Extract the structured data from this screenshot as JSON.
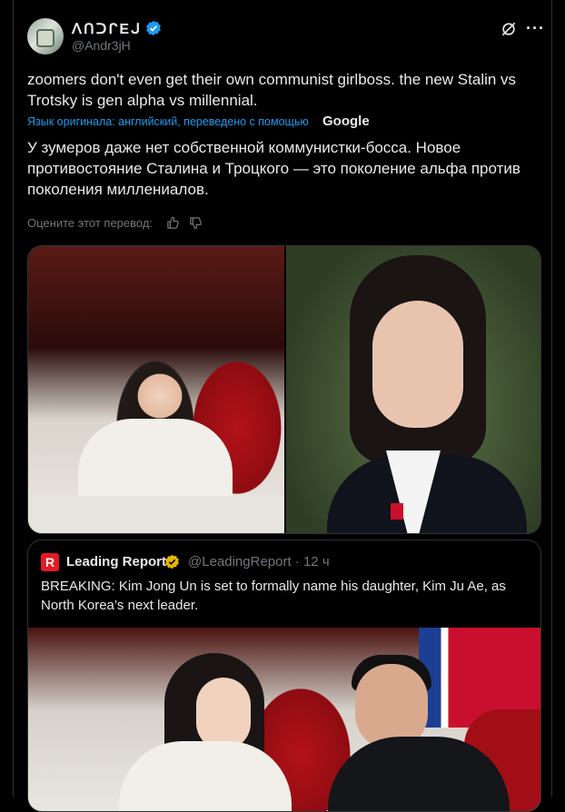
{
  "author": {
    "name": "ᐱᑎᑐᒋEᒍ",
    "handle": "@Andr3jH"
  },
  "tweet": {
    "text": "zoomers don't even get their own communist girlboss. the new Stalin vs Trotsky is gen alpha vs millennial.",
    "translated_note": "Язык оригинала: английский, переведено с помощью",
    "translator_brand": "Google",
    "translation": "У зумеров даже нет собственной коммунистки-босса. Новое противостояние Сталина и Троцкого — это поколение альфа против поколения миллениалов.",
    "rate_label": "Оцените этот перевод:"
  },
  "quote": {
    "logo_letter": "R",
    "name": "Leading Report",
    "handle_time": "@LeadingReport · 12 ч",
    "text": "BREAKING: Kim Jong Un is set to formally name his daughter, Kim Ju Ae, as North Korea’s next leader."
  },
  "icons": {
    "verified": "verified-badge-icon",
    "grok": "grok-icon",
    "more": "more-icon",
    "thumb_up": "thumb-up-icon",
    "thumb_down": "thumb-down-icon"
  },
  "colors": {
    "accent": "#1d9bf0",
    "background": "#000000",
    "muted": "#71767b",
    "text": "#e7e9ea"
  }
}
